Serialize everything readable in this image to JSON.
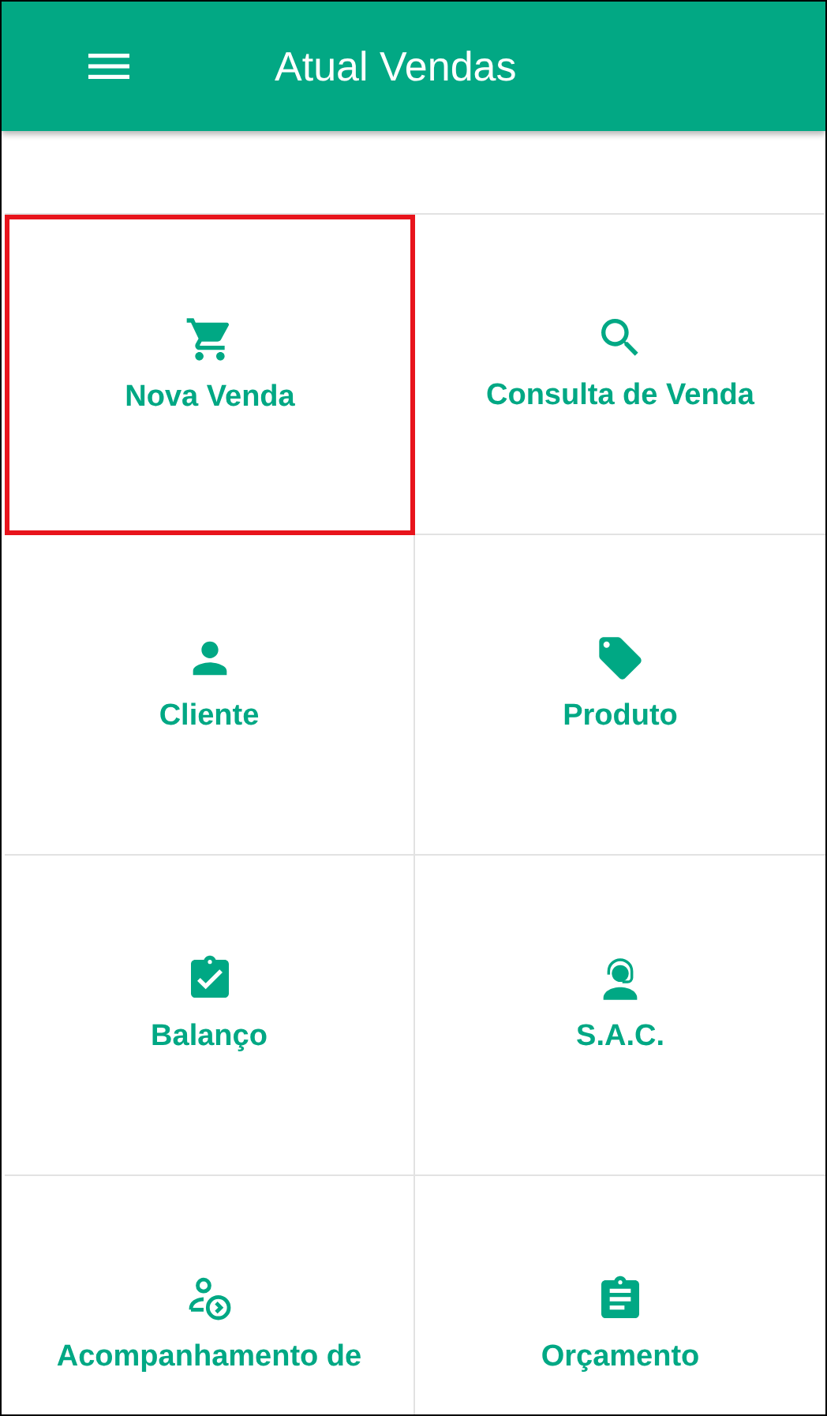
{
  "app_bar": {
    "title": "Atual Vendas"
  },
  "tiles": [
    {
      "kind": "cart",
      "label": "Nova Venda",
      "selected": true
    },
    {
      "kind": "search",
      "label": "Consulta de Venda",
      "selected": false
    },
    {
      "kind": "person",
      "label": "Cliente",
      "selected": false
    },
    {
      "kind": "tag",
      "label": "Produto",
      "selected": false
    },
    {
      "kind": "clipboard-check",
      "label": "Balanço",
      "selected": false
    },
    {
      "kind": "headset",
      "label": "S.A.C.",
      "selected": false
    },
    {
      "kind": "person-follow",
      "label": "Acompanhamento de",
      "selected": false
    },
    {
      "kind": "clipboard-list",
      "label": "Orçamento",
      "selected": false
    }
  ]
}
